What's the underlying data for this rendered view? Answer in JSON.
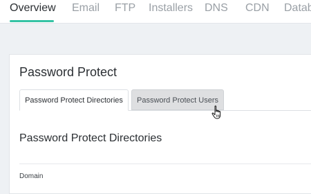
{
  "topnav": {
    "tabs": [
      {
        "label": "Overview"
      },
      {
        "label": "Email"
      },
      {
        "label": "FTP"
      },
      {
        "label": "Installers"
      },
      {
        "label": "DNS"
      },
      {
        "label": "CDN"
      },
      {
        "label": "Datab"
      }
    ],
    "active_index": 0,
    "accent_color": "#35c3a4"
  },
  "page": {
    "title": "Password Protect",
    "subtabs": [
      {
        "label": "Password Protect Directories",
        "active": true
      },
      {
        "label": "Password Protect Users",
        "active": false
      }
    ],
    "section_title": "Password Protect Directories",
    "table": {
      "columns": [
        "Domain"
      ]
    }
  },
  "cursor": {
    "icon": "hand-pointer-icon"
  }
}
